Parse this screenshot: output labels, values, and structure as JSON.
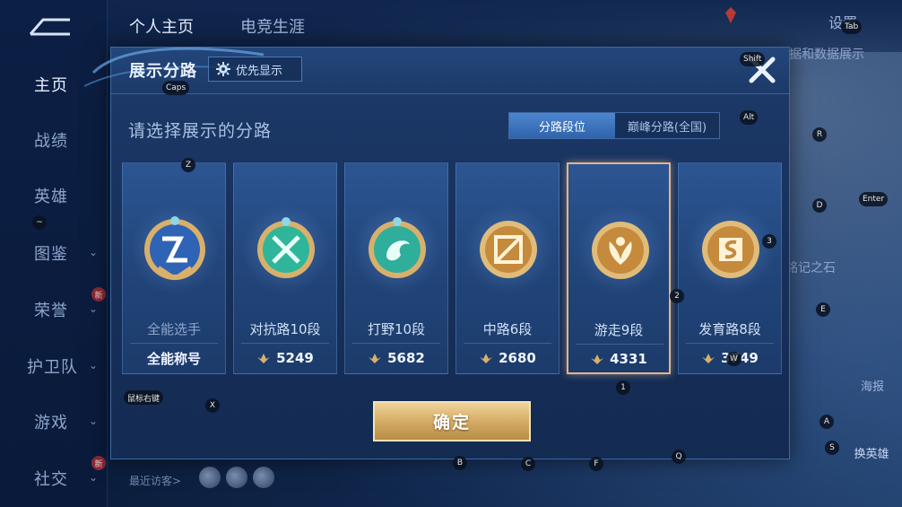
{
  "nav": {
    "items": [
      {
        "label": "主页",
        "active": true
      },
      {
        "label": "战绩"
      },
      {
        "label": "英雄"
      },
      {
        "label": "图鉴"
      },
      {
        "label": "荣誉"
      },
      {
        "label": "护卫队"
      },
      {
        "label": "游戏"
      },
      {
        "label": "社交"
      }
    ],
    "new_badge": "新"
  },
  "top_tabs": [
    "个人主页",
    "电竞生涯"
  ],
  "settings_label": "设置",
  "right_panel": {
    "data_label": "据和数据展示",
    "stone_label": "铭记之石",
    "poster_label": "海报",
    "swap_hero_label": "换英雄"
  },
  "visitors_label": "最近访客>",
  "modal": {
    "title": "展示分路",
    "priority_button": "优先显示",
    "subtitle": "请选择展示的分路",
    "toggle": {
      "selected": "分路段位",
      "other": "巅峰分路(全国)"
    },
    "confirm_label": "确定",
    "cards": [
      {
        "label": "全能选手",
        "score": "全能称号",
        "emblem": "all-round-emblem-icon",
        "selected": false
      },
      {
        "label": "对抗路10段",
        "score": "5249",
        "emblem": "clash-lane-emblem-icon",
        "selected": false
      },
      {
        "label": "打野10段",
        "score": "5682",
        "emblem": "jungle-emblem-icon",
        "selected": false
      },
      {
        "label": "中路6段",
        "score": "2680",
        "emblem": "mid-lane-emblem-icon",
        "selected": false
      },
      {
        "label": "游走9段",
        "score": "4331",
        "emblem": "roam-emblem-icon",
        "selected": true
      },
      {
        "label": "发育路8段",
        "score": "3749",
        "emblem": "farm-lane-emblem-icon",
        "selected": false
      }
    ]
  },
  "key_hints": [
    "Caps",
    "Shift",
    "Tab",
    "Alt",
    "R",
    "Z",
    "D",
    "Enter",
    "~",
    "3",
    "2",
    "E",
    "W",
    "1",
    "X",
    "鼠标右键",
    "A",
    "S",
    "B",
    "C",
    "F",
    "Q"
  ],
  "colors": {
    "accent_gold": "#d8b06a",
    "selected_border": "#e2b58a",
    "toggle_blue": "#3a72bd"
  }
}
